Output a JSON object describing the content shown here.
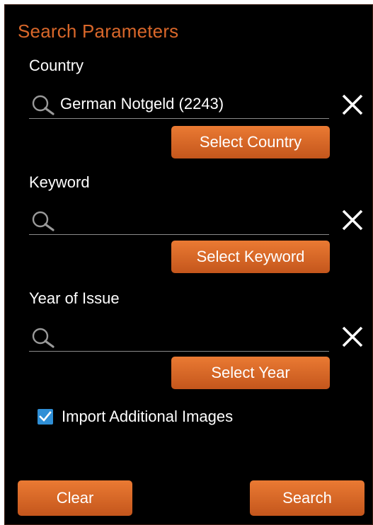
{
  "dialog": {
    "title": "Search Parameters"
  },
  "country": {
    "label": "Country",
    "value": "German Notgeld (2243)",
    "select_button": "Select Country"
  },
  "keyword": {
    "label": "Keyword",
    "value": "",
    "select_button": "Select Keyword"
  },
  "year": {
    "label": "Year of Issue",
    "value": "",
    "select_button": "Select Year"
  },
  "options": {
    "import_images_label": "Import Additional Images",
    "import_images_checked": true
  },
  "footer": {
    "clear_button": "Clear",
    "search_button": "Search"
  },
  "colors": {
    "accent": "#d9672a",
    "button_top": "#ea7a33",
    "button_bottom": "#c4561c",
    "checkbox": "#2f8fd6",
    "background": "#000000"
  }
}
